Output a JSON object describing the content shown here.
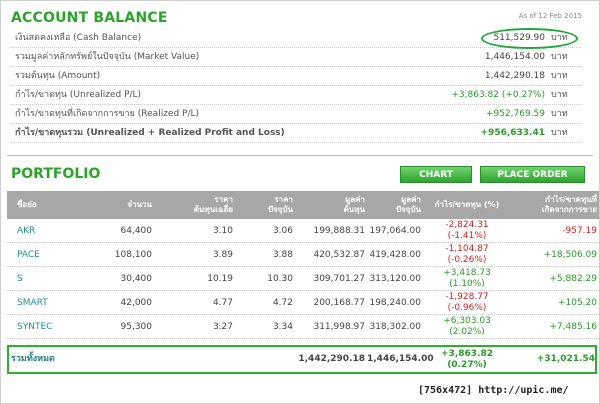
{
  "account": {
    "title": "ACCOUNT BALANCE",
    "as_of": "As of 12 Feb 2015",
    "rows": [
      {
        "label": "เงินสดคงเหลือ (Cash Balance)",
        "value": "511,529.90",
        "currency": "บาท"
      },
      {
        "label": "รวมมูลค่าหลักทรัพย์ในปัจจุบัน (Market Value)",
        "value": "1,446,154.00",
        "currency": "บาท"
      },
      {
        "label": "รวมต้นทุน (Amount)",
        "value": "1,442,290.18",
        "currency": "บาท"
      },
      {
        "label": "กำไร/ขาดทุน (Unrealized P/L)",
        "value": "+3,863.82 (+0.27%)",
        "currency": "บาท"
      },
      {
        "label": "กำไร/ขาดทุนที่เกิดจากการขาย (Realized P/L)",
        "value": "+952,769.59",
        "currency": "บาท"
      },
      {
        "label": "กำไร/ขาดทุนรวม (Unrealized + Realized Profit and Loss)",
        "value": "+956,633.41",
        "currency": "บาท"
      }
    ],
    "highlight_color": "#1ea83a"
  },
  "portfolio": {
    "title": "PORTFOLIO",
    "chart_button": "CHART",
    "place_order_button": "PLACE ORDER",
    "headers": {
      "symbol": "ชื่อย่อ",
      "volume": "จำนวน",
      "avg_cost_1": "ราคา",
      "avg_cost_2": "ต้นทุนเฉลี่ย",
      "market_price_1": "ราคา",
      "market_price_2": "ปัจจุบัน",
      "amount_1": "มูลค่า",
      "amount_2": "ต้นทุน",
      "market_value_1": "มูลค่า",
      "market_value_2": "ปัจจุบัน",
      "unrealized": "กำไร/ขาดทุน (%)",
      "realized_1": "กำไร/ขาดทุนที่",
      "realized_2": "เกิดจากการขาย"
    },
    "rows": [
      {
        "symbol": "AKR",
        "volume": "64,400",
        "avg_cost": "3.10",
        "market_price": "3.06",
        "amount": "199,888.31",
        "market_value": "197,064.00",
        "pl": "-2,824.31",
        "pl_pct": "(-1.41%)",
        "realized": "-957.19"
      },
      {
        "symbol": "PACE",
        "volume": "108,100",
        "avg_cost": "3.89",
        "market_price": "3.88",
        "amount": "420,532.87",
        "market_value": "419,428.00",
        "pl": "-1,104.87",
        "pl_pct": "(-0.26%)",
        "realized": "+18,506.09"
      },
      {
        "symbol": "S",
        "volume": "30,400",
        "avg_cost": "10.19",
        "market_price": "10.30",
        "amount": "309,701.27",
        "market_value": "313,120.00",
        "pl": "+3,418.73",
        "pl_pct": "(1.10%)",
        "realized": "+5,882.29"
      },
      {
        "symbol": "SMART",
        "volume": "42,000",
        "avg_cost": "4.77",
        "market_price": "4.72",
        "amount": "200,168.77",
        "market_value": "198,240.00",
        "pl": "-1,928.77",
        "pl_pct": "(-0.96%)",
        "realized": "+105.20"
      },
      {
        "symbol": "SYNTEC",
        "volume": "95,300",
        "avg_cost": "3.27",
        "market_price": "3.34",
        "amount": "311,998.97",
        "market_value": "318,302.00",
        "pl": "+6,303.03",
        "pl_pct": "(2.02%)",
        "realized": "+7,485.16"
      }
    ],
    "total": {
      "label": "รวมทั้งหมด",
      "amount": "1,442,290.18",
      "market_value": "1,446,154.00",
      "pl": "+3,863.82",
      "pl_pct": "(0.27%)",
      "realized": "+31,021.54"
    },
    "colors": {
      "gain": "#2a9a2a",
      "loss": "#d02020",
      "header_bg": "#a7a7a7",
      "accent": "#2aa52a"
    }
  },
  "watermark": "[756x472] http://upic.me/"
}
